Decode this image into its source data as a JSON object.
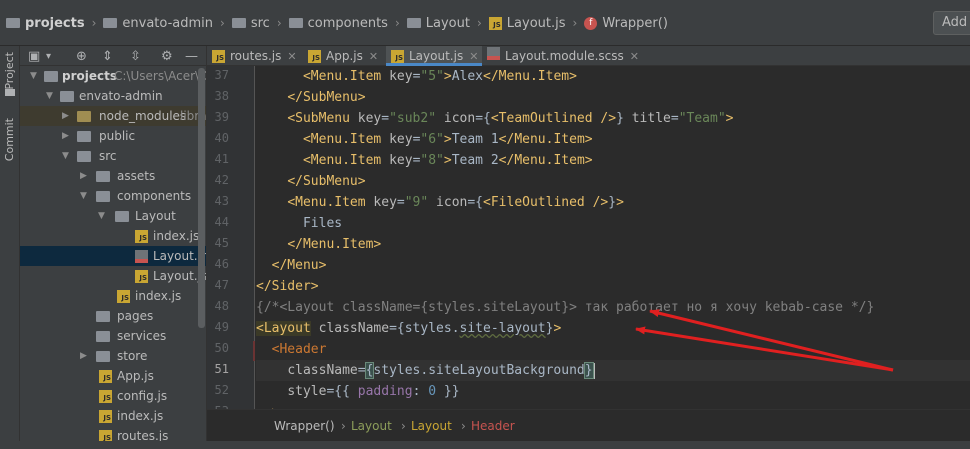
{
  "breadcrumb": {
    "items": [
      "projects",
      "envato-admin",
      "src",
      "components",
      "Layout",
      "Layout.js",
      "Wrapper()"
    ]
  },
  "add_button": "Add",
  "sidebar_strip": {
    "project_label": "Project",
    "commit_label": "Commit"
  },
  "project_tree": {
    "rows": [
      {
        "label": "projects",
        "extra": "C:\\Users\\Acer\\On"
      },
      {
        "label": "envato-admin"
      },
      {
        "label": "node_modules",
        "extra": "libra"
      },
      {
        "label": "public"
      },
      {
        "label": "src"
      },
      {
        "label": "assets"
      },
      {
        "label": "components"
      },
      {
        "label": "Layout"
      },
      {
        "label": "index.js"
      },
      {
        "label": "Layout.m"
      },
      {
        "label": "Layout.js"
      },
      {
        "label": "index.js"
      },
      {
        "label": "pages"
      },
      {
        "label": "services"
      },
      {
        "label": "store"
      },
      {
        "label": "App.js"
      },
      {
        "label": "config.js"
      },
      {
        "label": "index.js"
      },
      {
        "label": "routes.js"
      }
    ]
  },
  "tabs": [
    {
      "label": "routes.js"
    },
    {
      "label": "App.js"
    },
    {
      "label": "Layout.js",
      "active": true
    },
    {
      "label": "Layout.module.scss"
    }
  ],
  "editor": {
    "line_numbers": [
      "37",
      "38",
      "39",
      "40",
      "41",
      "42",
      "43",
      "44",
      "45",
      "46",
      "47",
      "48",
      "49",
      "50",
      "51",
      "52",
      "53"
    ],
    "current_line": "51"
  },
  "editor_breadcrumb": [
    "Wrapper()",
    "Layout",
    "Layout",
    "Header"
  ],
  "colors": {
    "tag": "#e8bf6a",
    "string": "#6a8759",
    "comment": "#808080",
    "arrow": "#e02020",
    "active_tab_underline": "#4a88c7"
  }
}
